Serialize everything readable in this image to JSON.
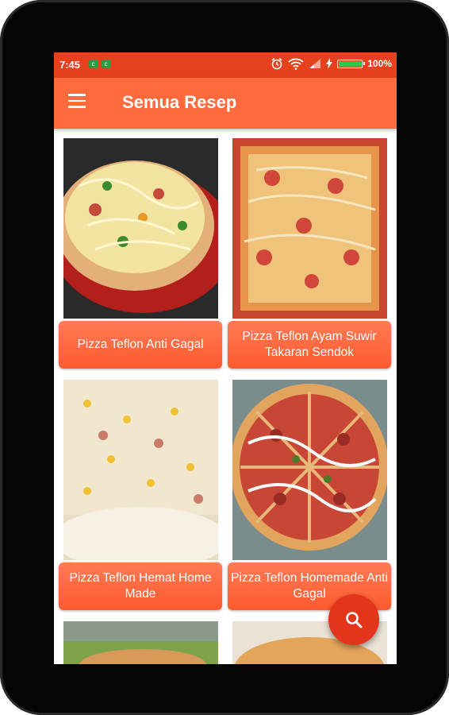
{
  "status_bar": {
    "time": "7:45",
    "battery_percent": "100%",
    "battery_level": 1.0,
    "notification_icons": [
      "notification-icon-1",
      "notification-icon-2"
    ],
    "right_icons": [
      "alarm-icon",
      "wifi-icon",
      "signal-icon",
      "charging-icon",
      "battery-icon"
    ]
  },
  "app_bar": {
    "title": "Semua Resep",
    "menu_icon": "hamburger-menu-icon"
  },
  "recipes": [
    {
      "title": "Pizza Teflon Anti Gagal",
      "image": "pizza-image"
    },
    {
      "title": "Pizza Teflon Ayam Suwir Takaran Sendok",
      "image": "pizza-image"
    },
    {
      "title": "Pizza Teflon Hemat Home Made",
      "image": "pizza-image"
    },
    {
      "title": "Pizza Teflon Homemade Anti Gagal",
      "image": "pizza-image"
    }
  ],
  "fab": {
    "icon": "search-icon"
  },
  "colors": {
    "status_bar": "#e5411c",
    "app_bar": "#ff6a3d",
    "card_label": "#ff6a3d",
    "fab": "#e5341c",
    "device_frame": "#050505"
  }
}
